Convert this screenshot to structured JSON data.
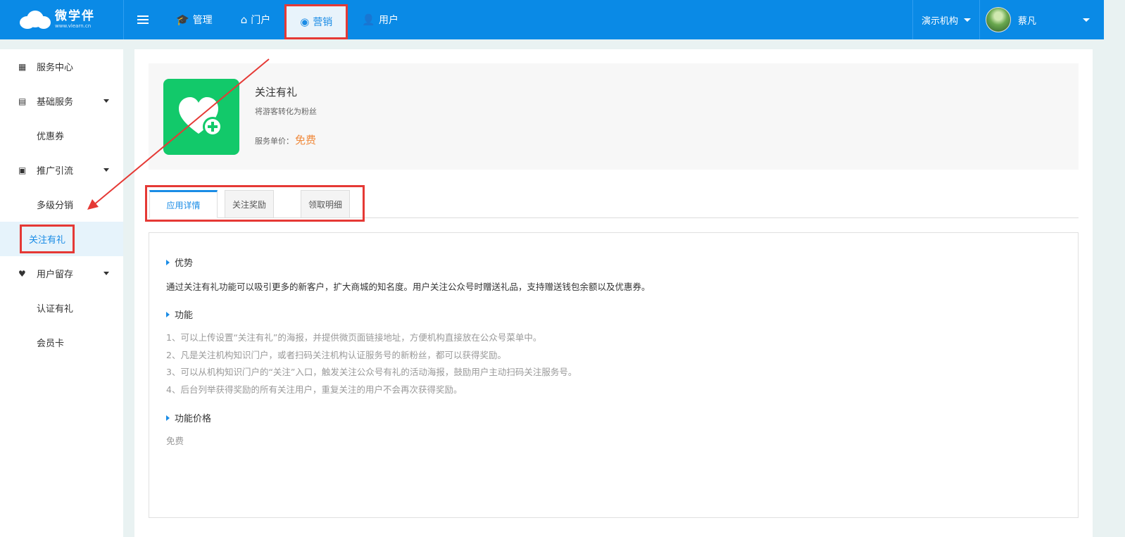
{
  "header": {
    "logo_main": "微学伴",
    "logo_sub": "www.vlearn.cn",
    "nav": [
      {
        "label": "管理",
        "icon": "graduation-cap-icon"
      },
      {
        "label": "门户",
        "icon": "home-icon"
      },
      {
        "label": "营销",
        "icon": "aperture-icon"
      },
      {
        "label": "用户",
        "icon": "user-gear-icon"
      }
    ],
    "org": "演示机构",
    "user_name": "蔡凡"
  },
  "sidebar": {
    "items": [
      {
        "label": "服务中心",
        "icon": "grid-icon"
      },
      {
        "label": "基础服务",
        "icon": "clipboard-icon"
      },
      {
        "label": "优惠券"
      },
      {
        "label": "推广引流",
        "icon": "money-icon"
      },
      {
        "label": "多级分销"
      },
      {
        "label": "关注有礼"
      },
      {
        "label": "用户留存",
        "icon": "hearts-icon"
      },
      {
        "label": "认证有礼"
      },
      {
        "label": "会员卡"
      }
    ]
  },
  "app": {
    "title": "关注有礼",
    "desc": "将游客转化为粉丝",
    "price_label": "服务单价：",
    "price_value": "免费"
  },
  "tabs": [
    "应用详情",
    "关注奖励",
    "领取明细"
  ],
  "detail": {
    "adv_title": "优势",
    "adv_text": "通过关注有礼功能可以吸引更多的新客户，扩大商城的知名度。用户关注公众号时赠送礼品，支持赠送钱包余额以及优惠券。",
    "func_title": "功能",
    "func_lines": [
      "1、可以上传设置“关注有礼”的海报，并提供微页面链接地址，方便机构直接放在公众号菜单中。",
      "2、凡是关注机构知识门户，或者扫码关注机构认证服务号的新粉丝，都可以获得奖励。",
      "3、可以从机构知识门户的“关注”入口，触发关注公众号有礼的活动海报，鼓励用户主动扫码关注服务号。",
      "4、后台列举获得奖励的所有关注用户，重复关注的用户不会再次获得奖励。"
    ],
    "price_title": "功能价格",
    "price_text": "免费"
  },
  "colors": {
    "primary": "#0a8ae6",
    "accent": "#1a8ce6",
    "price": "#f08a3c",
    "highlight": "#e53935",
    "app_icon": "#12c96a"
  }
}
